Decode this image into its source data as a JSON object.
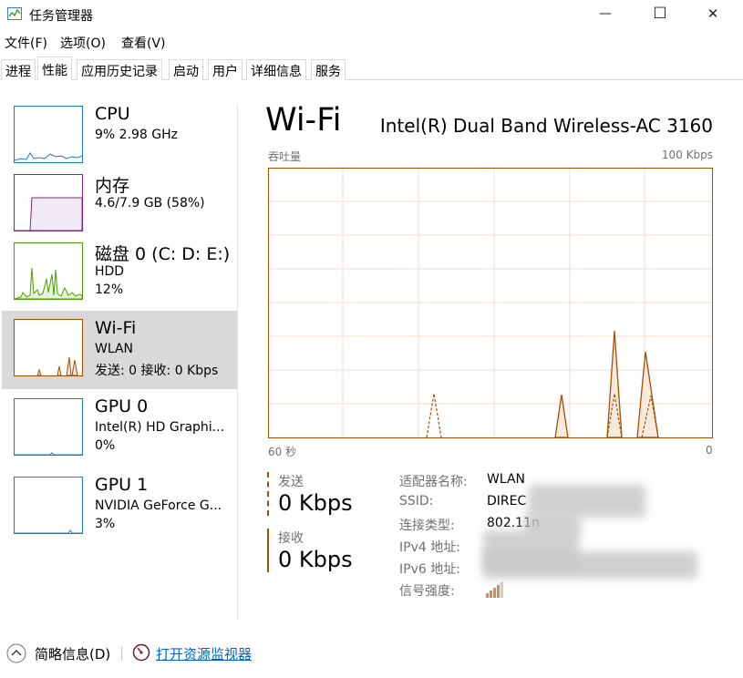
{
  "window": {
    "title": "任务管理器",
    "minimize_glyph": "—",
    "maximize_glyph": "☐",
    "close_glyph": "✕"
  },
  "menu": [
    {
      "label": "文件(F)"
    },
    {
      "label": "选项(O)"
    },
    {
      "label": "查看(V)"
    }
  ],
  "tabs": [
    {
      "label": "进程"
    },
    {
      "label": "性能",
      "active": true
    },
    {
      "label": "应用历史记录"
    },
    {
      "label": "启动"
    },
    {
      "label": "用户"
    },
    {
      "label": "详细信息"
    },
    {
      "label": "服务"
    }
  ],
  "sidebar": {
    "items": [
      {
        "name": "CPU",
        "line1": "9% 2.98 GHz",
        "line2": "",
        "color": "#1a7cc0"
      },
      {
        "name": "内存",
        "line1": "4.6/7.9 GB (58%)",
        "line2": "",
        "color": "#8b1c9c",
        "fill_fraction": 0.58
      },
      {
        "name": "磁盘 0 (C: D: E:)",
        "line1": "HDD",
        "line2": "12%",
        "color": "#4da000"
      },
      {
        "name": "Wi-Fi",
        "line1": "WLAN",
        "line2": "发送: 0 接收: 0 Kbps",
        "color": "#a74f01",
        "selected": true
      },
      {
        "name": "GPU 0",
        "line1": "Intel(R) HD Graphi...",
        "line2": "0%",
        "color": "#1a7cc0"
      },
      {
        "name": "GPU 1",
        "line1": "NVIDIA GeForce G...",
        "line2": "3%",
        "color": "#1a7cc0"
      }
    ]
  },
  "main": {
    "title": "Wi-Fi",
    "adapter": "Intel(R) Dual Band Wireless-AC 3160",
    "graph_label": "吞吐量",
    "graph_max": "100 Kbps",
    "time_left": "60 秒",
    "time_right": "0",
    "color": "#a74f01",
    "send": {
      "label": "发送",
      "value": "0 Kbps"
    },
    "receive": {
      "label": "接收",
      "value": "0 Kbps"
    },
    "info": [
      {
        "key": "适配器名称:",
        "value": "WLAN"
      },
      {
        "key": "SSID:",
        "value": "DIREC"
      },
      {
        "key": "连接类型:",
        "value": "802.11n"
      },
      {
        "key": "IPv4 地址:",
        "value": ""
      },
      {
        "key": "IPv6 地址:",
        "value": ""
      },
      {
        "key": "信号强度:",
        "value": ""
      }
    ],
    "signal_bars_filled": 4
  },
  "footer": {
    "summary": "简略信息(D)",
    "resource_monitor": "打开资源监视器"
  }
}
